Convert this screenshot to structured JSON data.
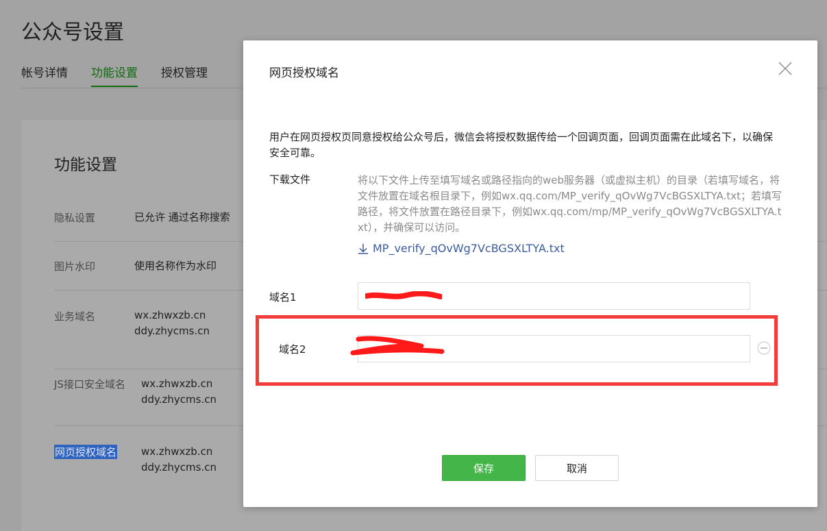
{
  "page": {
    "title": "公众号设置"
  },
  "tabs": [
    {
      "label": "帐号详情"
    },
    {
      "label": "功能设置"
    },
    {
      "label": "授权管理"
    }
  ],
  "card": {
    "title": "功能设置",
    "rows": [
      {
        "label": "隐私设置",
        "value": "已允许 通过名称搜索"
      },
      {
        "label": "图片水印",
        "value": "使用名称作为水印"
      },
      {
        "label": "业务域名",
        "values": [
          "wx.zhwxzb.cn",
          "ddy.zhycms.cn"
        ]
      },
      {
        "label": "JS接口安全域名",
        "values": [
          "wx.zhwxzb.cn",
          "ddy.zhycms.cn"
        ]
      },
      {
        "label": "网页授权域名",
        "values": [
          "wx.zhwxzb.cn",
          "ddy.zhycms.cn"
        ]
      }
    ]
  },
  "dialog": {
    "title": "网页授权域名",
    "description": "用户在网页授权页同意授权给公众号后，微信会将授权数据传给一个回调页面，回调页面需在此域名下，以确保安全可靠。",
    "download": {
      "label": "下载文件",
      "description": "将以下文件上传至填写域名或路径指向的web服务器（或虚拟主机）的目录（若填写域名，将文件放置在域名根目录下，例如wx.qq.com/MP_verify_qOvWg7VcBGSXLTYA.txt；若填写路径，将文件放置在路径目录下，例如wx.qq.com/mp/MP_verify_qOvWg7VcBGSXLTYA.txt），并确保可以访问。",
      "file_link": "MP_verify_qOvWg7VcBGSXLTYA.txt"
    },
    "fields": [
      {
        "label": "域名1",
        "value": ""
      },
      {
        "label": "域名2",
        "value": ""
      }
    ],
    "save_label": "保存",
    "cancel_label": "取消"
  },
  "colors": {
    "primary_green": "#44b549",
    "tab_active": "#0e6b0e",
    "highlight_red": "#f23c3c",
    "link_blue": "#3b5b9e",
    "overlay": "#a3a3a3"
  }
}
